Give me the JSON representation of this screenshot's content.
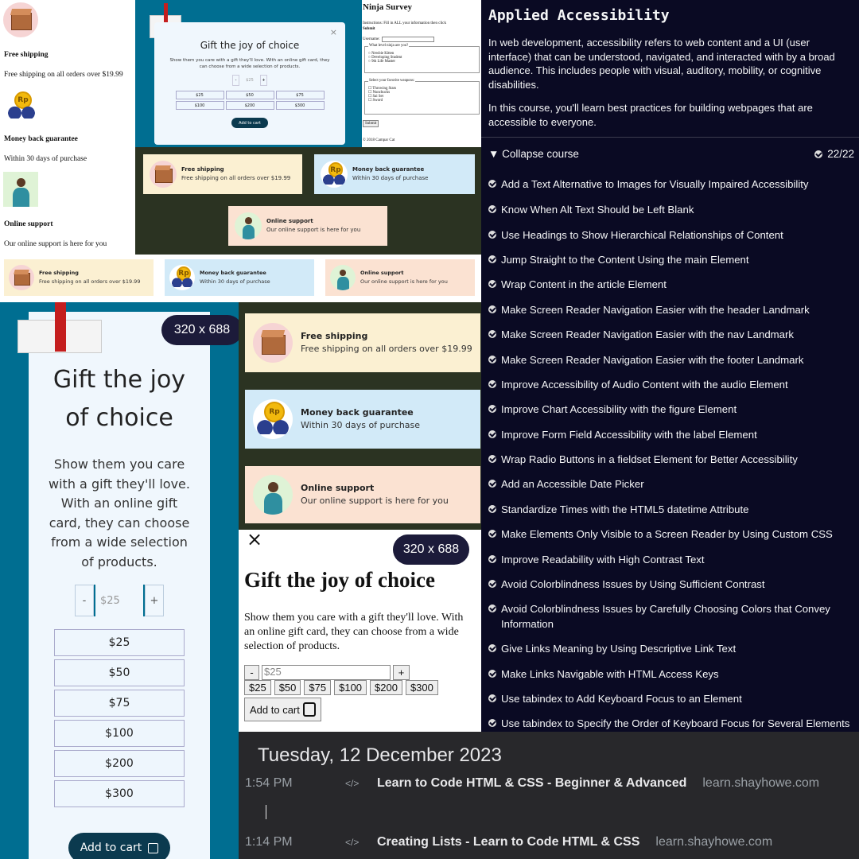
{
  "features": {
    "free_title": "Free shipping",
    "free_sub": "Free shipping on all orders over $19.99",
    "money_title": "Money back guarantee",
    "money_sub": "Within 30 days of purchase",
    "online_title": "Online support",
    "online_sub": "Our online support is here for you"
  },
  "gift_modal": {
    "title": "Gift the joy of choice",
    "desc": "Show them you care with a gift they'll love. With an online gift card, they can choose from a wide selection of products.",
    "minus": "-",
    "plus": "+",
    "amount_placeholder": "$25",
    "amounts": [
      "$25",
      "$50",
      "$75",
      "$100",
      "$200",
      "$300"
    ],
    "add_to_cart": "Add to cart",
    "close": "×",
    "viewport_badge": "320 x 688"
  },
  "ninja_survey": {
    "title": "Ninja Survey",
    "instructions": "Instructions: Fill in ALL your information then click",
    "instructions_bold": "Submit",
    "username_label": "Username:",
    "level_legend": "What level ninja are you?",
    "levels": [
      "Newbie Kitten",
      "Developing Student",
      "9th Life Master"
    ],
    "weapon_legend": "Select your favorite weapons:",
    "weapons": [
      "Throwing Stars",
      "Nunchucks",
      "Sai Set",
      "Sword"
    ],
    "submit": "Submit",
    "footer": "© 2018 Campar Cat"
  },
  "course": {
    "title": "Applied Accessibility",
    "intro1": "In web development, accessibility refers to web content and a UI (user interface) that can be understood, navigated, and interacted with by a broad audience. This includes people with visual, auditory, mobility, or cognitive disabilities.",
    "intro2": "In this course, you'll learn best practices for building webpages that are accessible to everyone.",
    "collapse": "Collapse course",
    "progress": "22/22",
    "lessons": [
      "Add a Text Alternative to Images for Visually Impaired Accessibility",
      "Know When Alt Text Should be Left Blank",
      "Use Headings to Show Hierarchical Relationships of Content",
      "Jump Straight to the Content Using the main Element",
      "Wrap Content in the article Element",
      "Make Screen Reader Navigation Easier with the header Landmark",
      "Make Screen Reader Navigation Easier with the nav Landmark",
      "Make Screen Reader Navigation Easier with the footer Landmark",
      "Improve Accessibility of Audio Content with the audio Element",
      "Improve Chart Accessibility with the figure Element",
      "Improve Form Field Accessibility with the label Element",
      "Wrap Radio Buttons in a fieldset Element for Better Accessibility",
      "Add an Accessible Date Picker",
      "Standardize Times with the HTML5 datetime Attribute",
      "Make Elements Only Visible to a Screen Reader by Using Custom CSS",
      "Improve Readability with High Contrast Text",
      "Avoid Colorblindness Issues by Using Sufficient Contrast",
      "Avoid Colorblindness Issues by Carefully Choosing Colors that Convey Information",
      "Give Links Meaning by Using Descriptive Link Text",
      "Make Links Navigable with HTML Access Keys",
      "Use tabindex to Add Keyboard Focus to an Element",
      "Use tabindex to Specify the Order of Keyboard Focus for Several Elements"
    ]
  },
  "history": {
    "date": "Tuesday, 12 December 2023",
    "entries": [
      {
        "time": "1:54 PM",
        "title": "Learn to Code HTML & CSS - Beginner & Advanced",
        "domain": "learn.shayhowe.com"
      },
      {
        "time": "1:14 PM",
        "title": "Creating Lists - Learn to Code HTML & CSS",
        "domain": "learn.shayhowe.com"
      }
    ]
  },
  "colors": {
    "teal": "#006e91",
    "dark_green": "#2b3322",
    "navy": "#0a0a23",
    "history_bg": "#28282b",
    "card_yellow": "#fbf0d2",
    "card_blue": "#d2eaf8",
    "card_peach": "#fbe2d2"
  }
}
